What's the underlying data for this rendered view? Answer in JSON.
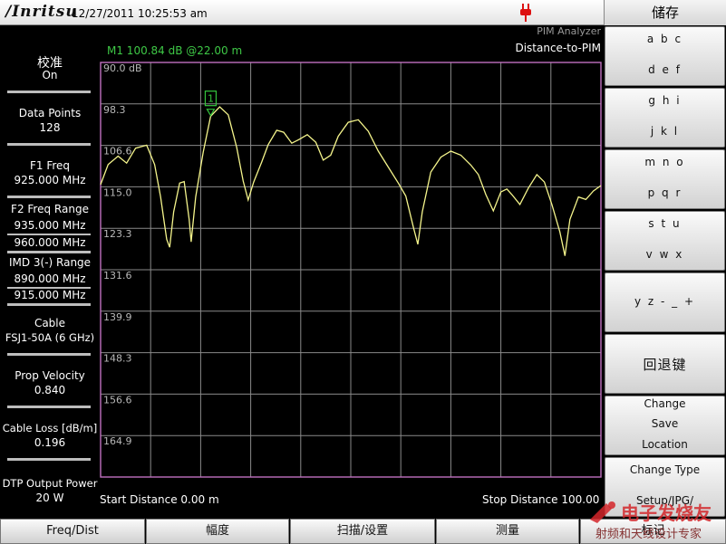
{
  "header": {
    "brand": "/Inritsu",
    "datetime": "12/27/2011 10:25:53 am"
  },
  "right_menu": {
    "title": "储存",
    "keys": [
      {
        "line1": "a b c",
        "line2": "d e f"
      },
      {
        "line1": "g h i",
        "line2": "j k l"
      },
      {
        "line1": "m n o",
        "line2": "p q r"
      },
      {
        "line1": "s t u",
        "line2": "v w x"
      },
      {
        "line1": "y z - _ +"
      },
      {
        "line1": "回退键"
      },
      {
        "line1": "Change",
        "line2": "Save",
        "line3": "Location"
      },
      {
        "line1": "Change Type",
        "line2": "Setup/JPG/"
      }
    ]
  },
  "params": [
    {
      "label": "校准",
      "value": "On"
    },
    {
      "label": "Data Points",
      "value": "128"
    },
    {
      "label": "F1 Freq",
      "value": "925.000 MHz"
    },
    {
      "label": "F2 Freq Range",
      "value": "935.000 MHz",
      "value2": "960.000 MHz"
    },
    {
      "label": "IMD 3(-) Range",
      "value": "890.000 MHz",
      "value2": "915.000 MHz"
    },
    {
      "label": "Cable",
      "value": "FSJ1-50A (6 GHz)"
    },
    {
      "label": "Prop Velocity",
      "value": "0.840"
    },
    {
      "label": "Cable Loss [dB/m]",
      "value": "0.196"
    },
    {
      "label": "DTP Output Power",
      "value": "20 W"
    }
  ],
  "analyzer": {
    "mode": "PIM Analyzer",
    "measurement": "Distance-to-PIM",
    "marker_readout": "M1 100.84 dB @22.00 m",
    "marker_label": "1",
    "start": "Start Distance 0.00 m",
    "stop": "Stop Distance 100.00 m"
  },
  "bottom_menu": [
    "Freq/Dist",
    "幅度",
    "扫描/设置",
    "测量",
    "标记"
  ],
  "colors": {
    "trace": "#f5f58c",
    "grid": "#8a8a8a",
    "marker": "#34c43c",
    "plot_border": "#c070c0",
    "axis_label": "#b8b8b8"
  },
  "watermark": {
    "line1": "电子发烧友",
    "line2": "射频和天线设计专家"
  },
  "chart_data": {
    "type": "line",
    "x_range": [
      0,
      100
    ],
    "ylim": [
      90,
      173.2
    ],
    "y_ticks": [
      "90.0 dB",
      "98.3",
      "106.6",
      "115.0",
      "123.3",
      "131.6",
      "139.9",
      "148.3",
      "156.6",
      "164.9"
    ],
    "y_reversed": true,
    "grid": true,
    "series": [
      {
        "values": [
          [
            0,
            114.5
          ],
          [
            1.5,
            110.5
          ],
          [
            3.5,
            108.8
          ],
          [
            5.2,
            110.2
          ],
          [
            7.0,
            107.2
          ],
          [
            9.2,
            106.6
          ],
          [
            10.8,
            110.5
          ],
          [
            12.0,
            117.0
          ],
          [
            13.2,
            125.5
          ],
          [
            13.8,
            127.1
          ],
          [
            14.6,
            120.0
          ],
          [
            15.8,
            114.2
          ],
          [
            16.7,
            113.9
          ],
          [
            17.7,
            121.5
          ],
          [
            18.1,
            126.0
          ],
          [
            19.0,
            117.0
          ],
          [
            20.5,
            108.0
          ],
          [
            22.0,
            100.8
          ],
          [
            23.8,
            98.9
          ],
          [
            25.5,
            100.5
          ],
          [
            27.2,
            107.0
          ],
          [
            28.5,
            113.8
          ],
          [
            29.5,
            117.6
          ],
          [
            30.6,
            114.0
          ],
          [
            32.2,
            110.0
          ],
          [
            33.5,
            106.5
          ],
          [
            35.2,
            103.6
          ],
          [
            36.6,
            104.0
          ],
          [
            38.2,
            106.2
          ],
          [
            39.6,
            105.5
          ],
          [
            41.3,
            104.5
          ],
          [
            43.0,
            106.0
          ],
          [
            44.5,
            109.6
          ],
          [
            46.0,
            108.6
          ],
          [
            47.5,
            104.8
          ],
          [
            49.5,
            102.0
          ],
          [
            51.5,
            101.5
          ],
          [
            53.5,
            103.8
          ],
          [
            55.5,
            107.8
          ],
          [
            57.5,
            111.0
          ],
          [
            59.5,
            114.2
          ],
          [
            61.0,
            116.8
          ],
          [
            62.5,
            123.0
          ],
          [
            63.4,
            126.5
          ],
          [
            64.3,
            120.0
          ],
          [
            66.0,
            112.0
          ],
          [
            68.0,
            109.0
          ],
          [
            70.0,
            107.8
          ],
          [
            72.0,
            108.6
          ],
          [
            74.0,
            110.6
          ],
          [
            75.5,
            112.5
          ],
          [
            77.0,
            116.5
          ],
          [
            78.5,
            119.8
          ],
          [
            80.0,
            116.0
          ],
          [
            81.2,
            115.4
          ],
          [
            82.2,
            116.5
          ],
          [
            83.8,
            118.5
          ],
          [
            85.5,
            115.2
          ],
          [
            87.2,
            112.5
          ],
          [
            88.7,
            114.0
          ],
          [
            90.2,
            118.5
          ],
          [
            91.8,
            124.0
          ],
          [
            92.8,
            128.8
          ],
          [
            93.8,
            121.5
          ],
          [
            95.5,
            117.0
          ],
          [
            97.0,
            117.5
          ],
          [
            98.5,
            115.8
          ],
          [
            100,
            114.7
          ]
        ]
      }
    ],
    "marker": {
      "x": 22.0,
      "y": 100.84
    }
  }
}
